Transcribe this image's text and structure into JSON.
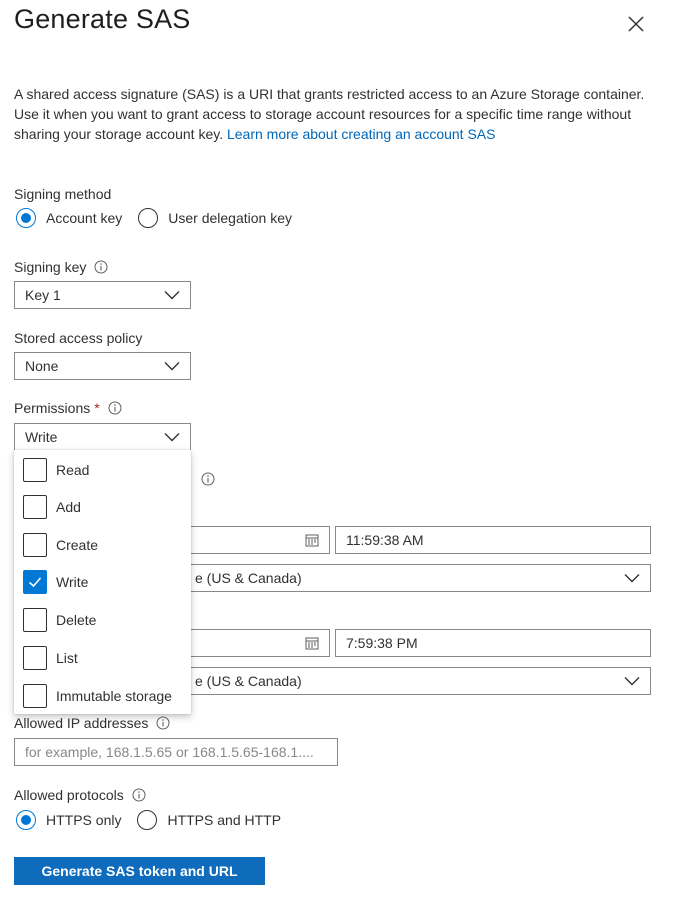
{
  "panel": {
    "title": "Generate SAS",
    "description": "A shared access signature (SAS) is a URI that grants restricted access to an Azure Storage container. Use it when you want to grant access to storage account resources for a specific time range without sharing your storage account key.",
    "learn_more": "Learn more about creating an account SAS"
  },
  "signing_method": {
    "label": "Signing method",
    "options": [
      "Account key",
      "User delegation key"
    ],
    "selected": "Account key"
  },
  "signing_key": {
    "label": "Signing key",
    "value": "Key 1"
  },
  "stored_access_policy": {
    "label": "Stored access policy",
    "value": "None"
  },
  "permissions": {
    "label": "Permissions",
    "required_mark": "*",
    "value": "Write",
    "options": [
      {
        "label": "Read",
        "checked": false
      },
      {
        "label": "Add",
        "checked": false
      },
      {
        "label": "Create",
        "checked": false
      },
      {
        "label": "Write",
        "checked": true
      },
      {
        "label": "Delete",
        "checked": false
      },
      {
        "label": "List",
        "checked": false
      },
      {
        "label": "Immutable storage",
        "checked": false
      }
    ]
  },
  "start": {
    "time": "11:59:38 AM",
    "timezone_partial": "e (US & Canada)"
  },
  "expiry": {
    "time": "7:59:38 PM",
    "timezone_partial": "e (US & Canada)"
  },
  "allowed_ip": {
    "label": "Allowed IP addresses",
    "placeholder": "for example, 168.1.5.65 or 168.1.5.65-168.1...."
  },
  "allowed_protocols": {
    "label": "Allowed protocols",
    "options": [
      "HTTPS only",
      "HTTPS and HTTP"
    ],
    "selected": "HTTPS only"
  },
  "generate_button": "Generate SAS token and URL",
  "colors": {
    "accent": "#0078d4",
    "button": "#0f6cbd",
    "link": "#0067b8",
    "required": "#a4262c"
  }
}
